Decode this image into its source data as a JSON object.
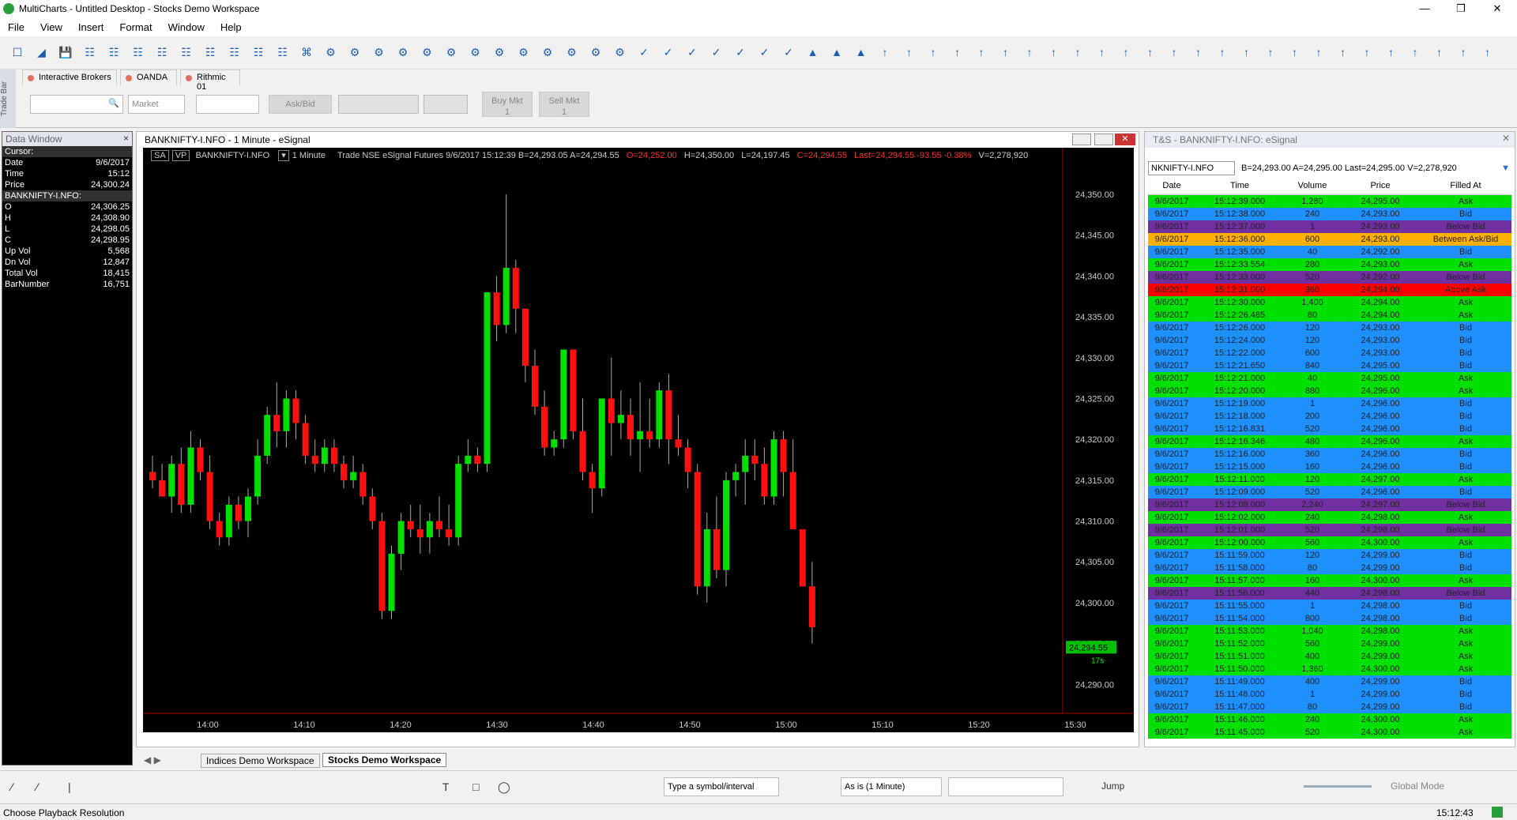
{
  "app": {
    "title": "MultiCharts - Untitled Desktop - Stocks Demo Workspace"
  },
  "menu": [
    "File",
    "View",
    "Insert",
    "Format",
    "Window",
    "Help"
  ],
  "tradebar": {
    "label": "Trade Bar",
    "brokers": [
      "Interactive Brokers",
      "OANDA",
      "Rithmic 01"
    ],
    "order_type": "Market",
    "ask_bid": "Ask/Bid",
    "buy_label": "Buy Mkt",
    "buy_qty": "1",
    "sell_label": "Sell Mkt",
    "sell_qty": "1"
  },
  "data_window": {
    "title": "Data Window",
    "rows": [
      {
        "k": "Cursor:",
        "v": "",
        "sec": true
      },
      {
        "k": "Date",
        "v": "9/6/2017"
      },
      {
        "k": "Time",
        "v": "15:12"
      },
      {
        "k": "Price",
        "v": "24,300.24"
      },
      {
        "k": "BANKNIFTY-I.NFO:",
        "v": "",
        "sec": true
      },
      {
        "k": "O",
        "v": "24,306.25"
      },
      {
        "k": "H",
        "v": "24,308.90"
      },
      {
        "k": "L",
        "v": "24,298.05"
      },
      {
        "k": "C",
        "v": "24,298.95"
      },
      {
        "k": "Up Vol",
        "v": "5,568"
      },
      {
        "k": "Dn Vol",
        "v": "12,847"
      },
      {
        "k": "Total Vol",
        "v": "18,415"
      },
      {
        "k": "BarNumber",
        "v": "16,751"
      }
    ]
  },
  "chart_window": {
    "title": "BANKNIFTY-I.NFO - 1 Minute - eSignal",
    "info": {
      "sa": "SA",
      "vp": "VP",
      "symbol": "BANKNIFTY-I.NFO",
      "interval": "1 Minute",
      "rest": "Trade  NSE  eSignal  Futures  9/6/2017  15:12:39  B=24,293.05  A=24,294.55",
      "o": "O=24,252.00",
      "h": "H=24,350.00",
      "l": "L=24,197.45",
      "c": "C=24,294.55",
      "last": "Last=24,294.55  -93.55  -0.38%",
      "v": "V=2,278,920"
    },
    "last_tag": "24,294.55",
    "timer": "17s"
  },
  "chart_data": {
    "type": "candlestick",
    "ylim": [
      24288,
      24353
    ],
    "yticks": [
      24290,
      24295,
      24300,
      24305,
      24310,
      24315,
      24320,
      24325,
      24330,
      24335,
      24340,
      24345,
      24350
    ],
    "ytick_labels": [
      "24,290.00",
      "24,295.00",
      "24,300.00",
      "24,305.00",
      "24,310.00",
      "24,315.00",
      "24,320.00",
      "24,325.00",
      "24,330.00",
      "24,335.00",
      "24,340.00",
      "24,345.00",
      "24,350.00"
    ],
    "xticks": [
      "14:00",
      "14:10",
      "14:20",
      "14:30",
      "14:40",
      "14:50",
      "15:00",
      "15:10",
      "15:20",
      "15:30"
    ],
    "grid": false,
    "candles": [
      [
        24316,
        24318,
        24314,
        24315
      ],
      [
        24315,
        24317,
        24313,
        24313
      ],
      [
        24313,
        24318,
        24311,
        24317
      ],
      [
        24317,
        24319,
        24311,
        24312
      ],
      [
        24312,
        24321,
        24311,
        24319
      ],
      [
        24319,
        24320,
        24315,
        24316
      ],
      [
        24316,
        24318,
        24309,
        24310
      ],
      [
        24310,
        24311,
        24307,
        24308
      ],
      [
        24308,
        24313,
        24307,
        24312
      ],
      [
        24312,
        24313,
        24309,
        24310
      ],
      [
        24310,
        24314,
        24308,
        24313
      ],
      [
        24313,
        24320,
        24312,
        24318
      ],
      [
        24318,
        24324,
        24317,
        24323
      ],
      [
        24323,
        24327,
        24319,
        24321
      ],
      [
        24321,
        24326,
        24319,
        24325
      ],
      [
        24325,
        24326,
        24320,
        24322
      ],
      [
        24322,
        24323,
        24317,
        24318
      ],
      [
        24318,
        24320,
        24316,
        24317
      ],
      [
        24317,
        24320,
        24316,
        24319
      ],
      [
        24319,
        24320,
        24316,
        24317
      ],
      [
        24317,
        24318,
        24314,
        24315
      ],
      [
        24315,
        24318,
        24314,
        24316
      ],
      [
        24316,
        24317,
        24312,
        24313
      ],
      [
        24313,
        24314,
        24309,
        24310
      ],
      [
        24310,
        24311,
        24298,
        24299
      ],
      [
        24299,
        24307,
        24298,
        24306
      ],
      [
        24306,
        24311,
        24304,
        24310
      ],
      [
        24310,
        24312,
        24308,
        24309
      ],
      [
        24309,
        24312,
        24306,
        24308
      ],
      [
        24308,
        24311,
        24306,
        24310
      ],
      [
        24310,
        24313,
        24308,
        24309
      ],
      [
        24309,
        24312,
        24307,
        24308
      ],
      [
        24308,
        24318,
        24307,
        24317
      ],
      [
        24317,
        24320,
        24316,
        24318
      ],
      [
        24318,
        24319,
        24316,
        24317
      ],
      [
        24317,
        24338,
        24316,
        24338
      ],
      [
        24338,
        24340,
        24332,
        24334
      ],
      [
        24334,
        24350,
        24333,
        24341
      ],
      [
        24341,
        24342,
        24333,
        24336
      ],
      [
        24336,
        24335,
        24327,
        24329
      ],
      [
        24329,
        24331,
        24323,
        24324
      ],
      [
        24324,
        24326,
        24318,
        24319
      ],
      [
        24319,
        24321,
        24318,
        24320
      ],
      [
        24320,
        24331,
        24319,
        24331
      ],
      [
        24331,
        24331,
        24320,
        24321
      ],
      [
        24321,
        24325,
        24315,
        24316
      ],
      [
        24316,
        24317,
        24311,
        24314
      ],
      [
        24314,
        24325,
        24313,
        24325
      ],
      [
        24325,
        24330,
        24318,
        24322
      ],
      [
        24322,
        24326,
        24320,
        24323
      ],
      [
        24323,
        24325,
        24318,
        24320
      ],
      [
        24320,
        24327,
        24316,
        24321
      ],
      [
        24321,
        24325,
        24319,
        24320
      ],
      [
        24320,
        24327,
        24319,
        24326
      ],
      [
        24326,
        24328,
        24317,
        24320
      ],
      [
        24320,
        24323,
        24318,
        24319
      ],
      [
        24319,
        24320,
        24314,
        24316
      ],
      [
        24316,
        24317,
        24301,
        24302
      ],
      [
        24302,
        24311,
        24300,
        24309
      ],
      [
        24309,
        24313,
        24303,
        24304
      ],
      [
        24304,
        24316,
        24302,
        24315
      ],
      [
        24315,
        24317,
        24313,
        24316
      ],
      [
        24316,
        24320,
        24312,
        24318
      ],
      [
        24318,
        24320,
        24315,
        24317
      ],
      [
        24317,
        24319,
        24312,
        24313
      ],
      [
        24313,
        24321,
        24312,
        24320
      ],
      [
        24320,
        24321,
        24313,
        24316
      ],
      [
        24316,
        24320,
        24310,
        24309
      ],
      [
        24309,
        24305,
        24303,
        24302
      ],
      [
        24302,
        24305,
        24295,
        24297
      ]
    ]
  },
  "ts": {
    "title": "T&S - BANKNIFTY-I.NFO: eSignal",
    "symbol": "NKNIFTY-I.NFO",
    "quote": "B=24,293.00 A=24,295.00 Last=24,295.00 V=2,278,920",
    "headers": [
      "Date",
      "Time",
      "Volume",
      "Price",
      "Filled At"
    ],
    "rows": [
      [
        "9/6/2017",
        "15:12:39.000",
        "1,280",
        "24,295.00",
        "Ask",
        "#00e000"
      ],
      [
        "9/6/2017",
        "15:12:38.000",
        "240",
        "24,293.00",
        "Bid",
        "#1e90ff"
      ],
      [
        "9/6/2017",
        "15:12:37.000",
        "1",
        "24,293.00",
        "Below Bid",
        "#7030a0"
      ],
      [
        "9/6/2017",
        "15:12:36.000",
        "600",
        "24,293.00",
        "Between Ask/Bid",
        "#ffb000"
      ],
      [
        "9/6/2017",
        "15:12:35.000",
        "40",
        "24,292.00",
        "Bid",
        "#1e90ff"
      ],
      [
        "9/6/2017",
        "15:12:33.554",
        "280",
        "24,293.00",
        "Ask",
        "#00e000"
      ],
      [
        "9/6/2017",
        "15:12:33.000",
        "520",
        "24,292.00",
        "Below Bid",
        "#7030a0"
      ],
      [
        "9/6/2017",
        "15:12:31.000",
        "360",
        "24,294.00",
        "Above Ask",
        "#ff0000"
      ],
      [
        "9/6/2017",
        "15:12:30.000",
        "1,400",
        "24,294.00",
        "Ask",
        "#00e000"
      ],
      [
        "9/6/2017",
        "15:12:26.485",
        "80",
        "24,294.00",
        "Ask",
        "#00e000"
      ],
      [
        "9/6/2017",
        "15:12:26.000",
        "120",
        "24,293.00",
        "Bid",
        "#1e90ff"
      ],
      [
        "9/6/2017",
        "15:12:24.000",
        "120",
        "24,293.00",
        "Bid",
        "#1e90ff"
      ],
      [
        "9/6/2017",
        "15:12:22.000",
        "600",
        "24,293.00",
        "Bid",
        "#1e90ff"
      ],
      [
        "9/6/2017",
        "15:12:21.650",
        "840",
        "24,295.00",
        "Bid",
        "#1e90ff"
      ],
      [
        "9/6/2017",
        "15:12:21.000",
        "40",
        "24,295.00",
        "Ask",
        "#00e000"
      ],
      [
        "9/6/2017",
        "15:12:20.000",
        "880",
        "24,296.00",
        "Ask",
        "#00e000"
      ],
      [
        "9/6/2017",
        "15:12:19.000",
        "1",
        "24,296.00",
        "Bid",
        "#1e90ff"
      ],
      [
        "9/6/2017",
        "15:12:18.000",
        "200",
        "24,296.00",
        "Bid",
        "#1e90ff"
      ],
      [
        "9/6/2017",
        "15:12:16.831",
        "520",
        "24,296.00",
        "Bid",
        "#1e90ff"
      ],
      [
        "9/6/2017",
        "15:12:16.346",
        "480",
        "24,296.00",
        "Ask",
        "#00e000"
      ],
      [
        "9/6/2017",
        "15:12:16.000",
        "360",
        "24,296.00",
        "Bid",
        "#1e90ff"
      ],
      [
        "9/6/2017",
        "15:12:15.000",
        "160",
        "24,296.00",
        "Bid",
        "#1e90ff"
      ],
      [
        "9/6/2017",
        "15:12:11.000",
        "120",
        "24,297.00",
        "Ask",
        "#00e000"
      ],
      [
        "9/6/2017",
        "15:12:09.000",
        "520",
        "24,296.00",
        "Bid",
        "#1e90ff"
      ],
      [
        "9/6/2017",
        "15:12:08.000",
        "2,240",
        "24,297.00",
        "Below Bid",
        "#7030a0"
      ],
      [
        "9/6/2017",
        "15:12:02.000",
        "240",
        "24,298.00",
        "Ask",
        "#00e000"
      ],
      [
        "9/6/2017",
        "15:12:01.000",
        "520",
        "24,298.00",
        "Below Bid",
        "#7030a0"
      ],
      [
        "9/6/2017",
        "15:12:00.000",
        "560",
        "24,300.00",
        "Ask",
        "#00e000"
      ],
      [
        "9/6/2017",
        "15:11:59.000",
        "120",
        "24,299.00",
        "Bid",
        "#1e90ff"
      ],
      [
        "9/6/2017",
        "15:11:58.000",
        "80",
        "24,299.00",
        "Bid",
        "#1e90ff"
      ],
      [
        "9/6/2017",
        "15:11:57.000",
        "160",
        "24,300.00",
        "Ask",
        "#00e000"
      ],
      [
        "9/6/2017",
        "15:11:56.000",
        "440",
        "24,298.00",
        "Below Bid",
        "#7030a0"
      ],
      [
        "9/6/2017",
        "15:11:55.000",
        "1",
        "24,298.00",
        "Bid",
        "#1e90ff"
      ],
      [
        "9/6/2017",
        "15:11:54.000",
        "800",
        "24,298.00",
        "Bid",
        "#1e90ff"
      ],
      [
        "9/6/2017",
        "15:11:53.000",
        "1,040",
        "24,298.00",
        "Ask",
        "#00e000"
      ],
      [
        "9/6/2017",
        "15:11:52.000",
        "560",
        "24,299.00",
        "Ask",
        "#00e000"
      ],
      [
        "9/6/2017",
        "15:11:51.000",
        "400",
        "24,299.00",
        "Ask",
        "#00e000"
      ],
      [
        "9/6/2017",
        "15:11:50.000",
        "1,360",
        "24,300.00",
        "Ask",
        "#00e000"
      ],
      [
        "9/6/2017",
        "15:11:49.000",
        "400",
        "24,299.00",
        "Bid",
        "#1e90ff"
      ],
      [
        "9/6/2017",
        "15:11:48.000",
        "1",
        "24,299.00",
        "Bid",
        "#1e90ff"
      ],
      [
        "9/6/2017",
        "15:11:47.000",
        "80",
        "24,299.00",
        "Bid",
        "#1e90ff"
      ],
      [
        "9/6/2017",
        "15:11:46.000",
        "240",
        "24,300.00",
        "Ask",
        "#00e000"
      ],
      [
        "9/6/2017",
        "15:11:45.000",
        "520",
        "24,300.00",
        "Ask",
        "#00e000"
      ]
    ]
  },
  "workspace_tabs": [
    "Indices Demo Workspace",
    "Stocks Demo Workspace"
  ],
  "drawbar": {
    "symbol_placeholder": "Type a symbol/interval",
    "resolution": "As is (1 Minute)",
    "jump": "Jump",
    "global": "Global Mode"
  },
  "status": {
    "left": "Choose Playback Resolution",
    "time": "15:12:43"
  }
}
